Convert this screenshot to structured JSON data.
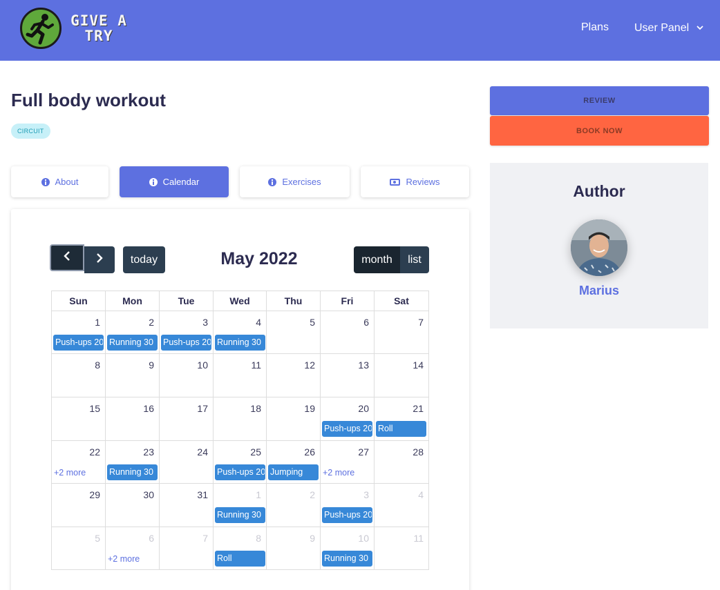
{
  "navbar": {
    "logo_text": "GIVE A TRY",
    "links": {
      "plans": "Plans",
      "user_panel": "User Panel"
    }
  },
  "workout": {
    "title": "Full body workout",
    "badge": "CIRCUIT"
  },
  "tabs": {
    "about": "About",
    "calendar": "Calendar",
    "exercises": "Exercises",
    "reviews": "Reviews",
    "active": "Calendar"
  },
  "calendar": {
    "title": "May 2022",
    "buttons": {
      "today": "today",
      "month": "month",
      "list": "list"
    },
    "weekdays": [
      "Sun",
      "Mon",
      "Tue",
      "Wed",
      "Thu",
      "Fri",
      "Sat"
    ],
    "weeks": [
      [
        {
          "day": "1",
          "event": "Push-ups 20"
        },
        {
          "day": "2",
          "event": "Running 30"
        },
        {
          "day": "3",
          "event": "Push-ups 20"
        },
        {
          "day": "4",
          "event": "Running 30"
        },
        {
          "day": "5"
        },
        {
          "day": "6"
        },
        {
          "day": "7"
        }
      ],
      [
        {
          "day": "8"
        },
        {
          "day": "9"
        },
        {
          "day": "10"
        },
        {
          "day": "11"
        },
        {
          "day": "12"
        },
        {
          "day": "13"
        },
        {
          "day": "14"
        }
      ],
      [
        {
          "day": "15"
        },
        {
          "day": "16"
        },
        {
          "day": "17"
        },
        {
          "day": "18"
        },
        {
          "day": "19"
        },
        {
          "day": "20",
          "event": "Push-ups 20"
        },
        {
          "day": "21",
          "event": "Roll"
        }
      ],
      [
        {
          "day": "22",
          "more": "+2 more"
        },
        {
          "day": "23",
          "event": "Running 30"
        },
        {
          "day": "24"
        },
        {
          "day": "25",
          "event": "Push-ups 20"
        },
        {
          "day": "26",
          "event": "Jumping"
        },
        {
          "day": "27",
          "more": "+2 more"
        },
        {
          "day": "28"
        }
      ],
      [
        {
          "day": "29"
        },
        {
          "day": "30"
        },
        {
          "day": "31"
        },
        {
          "day": "1",
          "other": true,
          "event": "Running 30"
        },
        {
          "day": "2",
          "other": true
        },
        {
          "day": "3",
          "other": true,
          "event": "Push-ups 20"
        },
        {
          "day": "4",
          "other": true
        }
      ],
      [
        {
          "day": "5",
          "other": true
        },
        {
          "day": "6",
          "other": true,
          "more": "+2 more"
        },
        {
          "day": "7",
          "other": true
        },
        {
          "day": "8",
          "other": true,
          "event": "Roll"
        },
        {
          "day": "9",
          "other": true
        },
        {
          "day": "10",
          "other": true,
          "event": "Running 30"
        },
        {
          "day": "11",
          "other": true
        }
      ]
    ]
  },
  "actions": {
    "review": "REVIEW",
    "book_now": "BOOK NOW"
  },
  "author": {
    "heading": "Author",
    "name": "Marius"
  },
  "colors": {
    "primary": "#5d70e0",
    "book": "#ff6541",
    "event": "#3788d8",
    "calendar_button": "#2c3e50"
  },
  "icons": [
    "runner-logo",
    "chevron-down-icon",
    "info-icon",
    "money-icon",
    "chevron-left-icon",
    "chevron-right-icon"
  ]
}
